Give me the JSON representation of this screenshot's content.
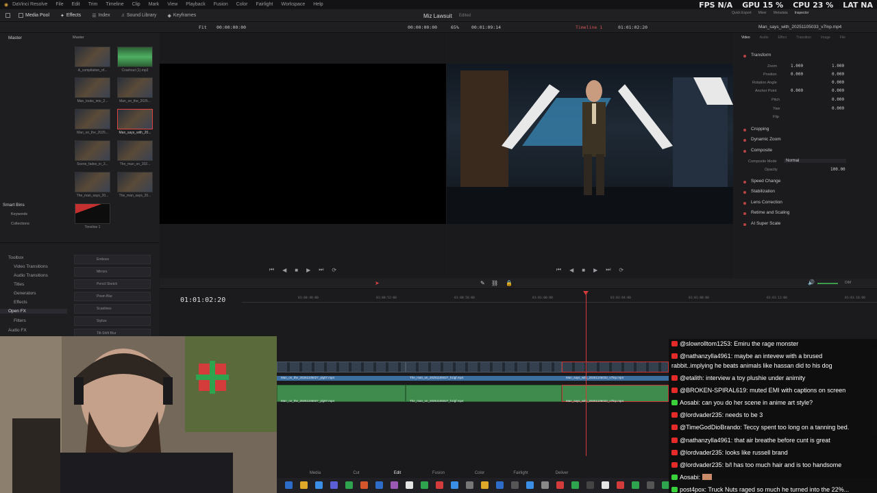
{
  "menubar": {
    "app_name": "DaVinci Resolve",
    "items": [
      "File",
      "Edit",
      "Trim",
      "Timeline",
      "Clip",
      "Mark",
      "View",
      "Playback",
      "Fusion",
      "Color",
      "Fairlight",
      "Workspace",
      "Help"
    ]
  },
  "system_stats": {
    "fps": "FPS N/A",
    "gpu": "GPU 15 %",
    "cpu": "CPU 23 %",
    "lat": "LAT NA"
  },
  "toolbar": {
    "items": [
      "Media Pool",
      "Effects",
      "Index",
      "Sound Library",
      "Keyframes"
    ],
    "right_items": [
      "Quick Export",
      "Mixer",
      "Metadata",
      "Inspector"
    ]
  },
  "project": {
    "title": "Miz Lawsuit",
    "status": "Edited"
  },
  "viewer_bar": {
    "src_zoom": "Fit",
    "src_tc": "00:00:00:00",
    "src_dur": "00:00:00:00",
    "prog_zoom": "65%",
    "prog_dur": "00:01:09:14",
    "timeline_name": "Timeline 1",
    "prog_tc": "01:01:02:20",
    "clip_name": "Man_says_with_20251105033_v7lnp.mp4"
  },
  "media_pool": {
    "header": "Master",
    "bins_header": "Master",
    "clips": [
      {
        "label": "A_compilation_of...",
        "type": "video"
      },
      {
        "label": "Crashout (1).mp3",
        "type": "audio"
      },
      {
        "label": "Man_looks_into_2...",
        "type": "video"
      },
      {
        "label": "Man_on_the_2025...",
        "type": "video"
      },
      {
        "label": "Man_on_the_2025...",
        "type": "video"
      },
      {
        "label": "Man_says_with_20...",
        "type": "video",
        "selected": true
      },
      {
        "label": "Scene_fades_in_2...",
        "type": "video"
      },
      {
        "label": "The_man_on_202...",
        "type": "video"
      },
      {
        "label": "The_man_says_20...",
        "type": "video"
      },
      {
        "label": "The_man_says_20...",
        "type": "video"
      },
      {
        "label": "Timeline 1",
        "type": "timeline"
      }
    ],
    "smart_bins": {
      "title": "Smart Bins",
      "items": [
        "Keywords",
        "Collections"
      ]
    }
  },
  "effects": {
    "tree": [
      "Toolbox",
      "Video Transitions",
      "Audio Transitions",
      "Titles",
      "Generators",
      "Effects",
      "Open FX",
      "Filters",
      "Audio FX"
    ],
    "list": [
      "Emboss",
      "Mirrors",
      "Pencil Sketch",
      "Prism Blur",
      "Scanlines",
      "Stylize",
      "Tilt-Shift Blur"
    ]
  },
  "inspector": {
    "tabs": [
      "Video",
      "Audio",
      "Effect",
      "Transition",
      "Image",
      "File"
    ],
    "transform": {
      "title": "Transform",
      "zoom_x": "1.000",
      "zoom_y": "1.000",
      "position_x": "0.000",
      "position_y": "0.000",
      "rotation": "0.000",
      "anchor_x": "0.000",
      "anchor_y": "0.000",
      "pitch": "0.000",
      "yaw": "0.000",
      "labels": [
        "Zoom",
        "Position",
        "Rotation Angle",
        "Anchor Point",
        "Pitch",
        "Yaw",
        "Flip"
      ]
    },
    "sections": [
      "Cropping",
      "Dynamic Zoom",
      "Composite",
      "Speed Change",
      "Stabilization",
      "Lens Correction",
      "Retime and Scaling",
      "AI Super Scale"
    ],
    "composite": {
      "mode_label": "Composite Mode",
      "mode": "Normal",
      "opacity_label": "Opacity",
      "opacity": "100.00"
    }
  },
  "timeline": {
    "timecode": "01:01:02:20",
    "ruler": [
      "01:00:48:00",
      "01:00:52:00",
      "01:00:56:00",
      "01:01:00:00",
      "01:01:04:00",
      "01:01:08:00",
      "01:01:12:00",
      "01:01:16:00"
    ],
    "clips": [
      {
        "name": "Man_on_the_20251105027_ylg07.mp4"
      },
      {
        "name": "The_man_on_20251105027_h1lgf.mp4"
      },
      {
        "name": "Man_says_with_20251105033_v7lnp.mp4"
      }
    ],
    "audio_clips": [
      {
        "name": "Man_on_the_20251105027_ylg07.mp4"
      },
      {
        "name": "The_man_on_20251105027_h1lgf.mp4"
      },
      {
        "name": "Man_says_with_20251105033_v7lnp.mp4"
      }
    ],
    "volume_label": "DIM"
  },
  "pages": [
    "Media",
    "Cut",
    "Edit",
    "Fusion",
    "Color",
    "Fairlight",
    "Deliver"
  ],
  "active_page": "Edit",
  "chat": [
    {
      "platform": "yt",
      "text": "@slowrolltom1253: Emiru the rage monster"
    },
    {
      "platform": "yt",
      "text": "@nathanzylla4961: maybe an intevew with a brused"
    },
    {
      "platform": "",
      "text": "rabbit..implying he beats animals like hassan did to his dog"
    },
    {
      "platform": "yt",
      "text": "@etalith: interview a toy plushie under animity"
    },
    {
      "platform": "yt",
      "text": "@BROKEN-SPIRAL619: muted EMI with captions on screen"
    },
    {
      "platform": "kick",
      "text": "Aosabi: can you do her scene in anime art style?"
    },
    {
      "platform": "yt",
      "text": "@lordvader235: needs to be 3"
    },
    {
      "platform": "yt",
      "text": "@TimeGodDioBrando: Teccy spent too long on a tanning bed."
    },
    {
      "platform": "yt",
      "text": "@nathanzylla4961: that air breathe before cunt is great"
    },
    {
      "platform": "yt",
      "text": "@lordvader235: looks like russell brand"
    },
    {
      "platform": "yt",
      "text": "@lordvader235: b/l has too much hair and is too handsome"
    },
    {
      "platform": "kick",
      "text": "Aosabi:"
    },
    {
      "platform": "kick",
      "text": "post4pox: Truck Nuts raged so much he turned into the 22%..."
    }
  ],
  "colors": {
    "accent_red": "#d43c3c",
    "clip_blue": "#3c6fa0",
    "audio_green": "#3f8a4d",
    "yt": "#e52a2a",
    "kick": "#3ad13a"
  }
}
